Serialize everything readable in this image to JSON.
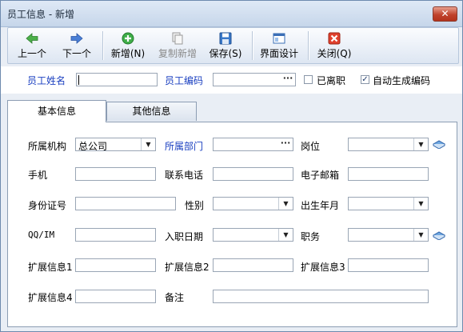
{
  "window": {
    "title": "员工信息 - 新增",
    "close_label": "✕"
  },
  "toolbar": {
    "prev": "上一个",
    "next": "下一个",
    "new": "新增(N)",
    "copy_new": "复制新增",
    "save": "保存(S)",
    "ui_design": "界面设计",
    "close": "关闭(Q)"
  },
  "top": {
    "name_label": "员工姓名",
    "name_value": "",
    "code_label": "员工编码",
    "code_value": "",
    "resigned_label": "已离职",
    "resigned_checked": false,
    "autocode_label": "自动生成编码",
    "autocode_checked": true
  },
  "tabs": {
    "basic": "基本信息",
    "other": "其他信息"
  },
  "form": {
    "org_label": "所属机构",
    "org_value": "总公司",
    "dept_label": "所属部门",
    "dept_value": "",
    "position_label": "岗位",
    "position_value": "",
    "mobile_label": "手机",
    "mobile_value": "",
    "phone_label": "联系电话",
    "phone_value": "",
    "email_label": "电子邮箱",
    "email_value": "",
    "idcard_label": "身份证号",
    "idcard_value": "",
    "gender_label": "性别",
    "gender_value": "",
    "birth_label": "出生年月",
    "birth_value": "",
    "qq_label": "QQ/IM",
    "qq_value": "",
    "hire_label": "入职日期",
    "hire_value": "",
    "title_label": "职务",
    "title_value": "",
    "ext1_label": "扩展信息1",
    "ext1_value": "",
    "ext2_label": "扩展信息2",
    "ext2_value": "",
    "ext3_label": "扩展信息3",
    "ext3_value": "",
    "ext4_label": "扩展信息4",
    "ext4_value": "",
    "remark_label": "备注",
    "remark_value": ""
  },
  "colors": {
    "label_blue": "#1a3fc0",
    "toolbar_bg": "#dde6f2",
    "window_bg": "#e9eef5"
  }
}
